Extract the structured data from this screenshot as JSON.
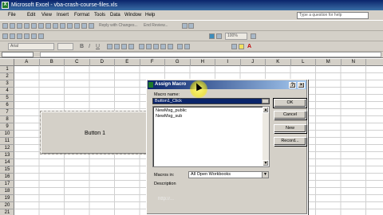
{
  "window": {
    "title": "Microsoft Excel - vba-crash-course-files.xls"
  },
  "menubar": {
    "items": [
      "File",
      "Edit",
      "View",
      "Insert",
      "Format",
      "Tools",
      "Data",
      "Window",
      "Help"
    ],
    "ask_placeholder": "Type a question for help"
  },
  "toolbar": {
    "reply_label": "Reply with Changes...",
    "end_review_label": "End Review...",
    "font_name": "Arial",
    "zoom": "100%"
  },
  "columns": [
    "A",
    "B",
    "C",
    "D",
    "E",
    "F",
    "G",
    "H",
    "I",
    "J",
    "K",
    "L",
    "M",
    "N"
  ],
  "rows": [
    "1",
    "2",
    "3",
    "4",
    "5",
    "6",
    "7",
    "8",
    "9",
    "10",
    "11",
    "12",
    "13",
    "14",
    "15",
    "16",
    "17",
    "18",
    "19",
    "20",
    "21"
  ],
  "sheet_button": {
    "label": "Button 1"
  },
  "dialog": {
    "title": "Assign Macro",
    "help_glyph": "?",
    "close_glyph": "×",
    "macro_name_label": "Macro name:",
    "macro_name_value": "Button1_Click",
    "macros": [
      "NewMsg_public",
      "NewMsg_sub"
    ],
    "buttons": {
      "ok": "OK",
      "cancel": "Cancel",
      "new": "New",
      "record": "Record..."
    },
    "macros_in_label": "Macros in:",
    "macros_in_value": "All Open Workbooks",
    "description_label": "Description"
  },
  "watermark": "http://..."
}
